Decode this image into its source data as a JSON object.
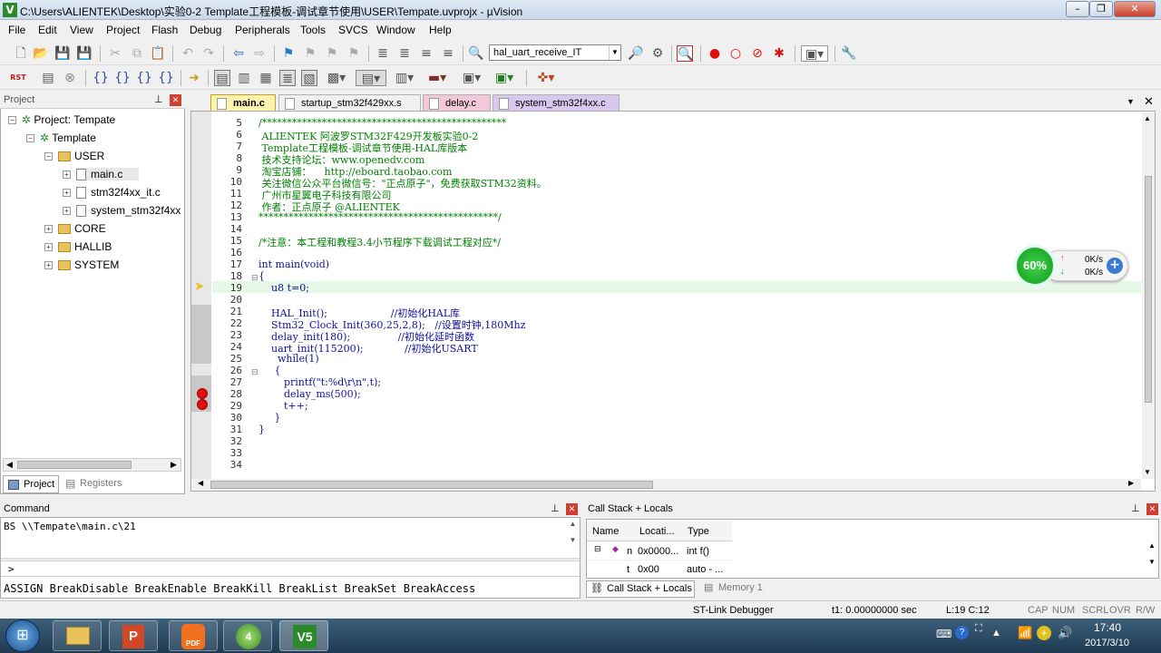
{
  "window": {
    "title": "C:\\Users\\ALIENTEK\\Desktop\\实验0-2 Template工程模板-调试章节使用\\USER\\Tempate.uvprojx - µVision"
  },
  "menu": [
    "File",
    "Edit",
    "View",
    "Project",
    "Flash",
    "Debug",
    "Peripherals",
    "Tools",
    "SVCS",
    "Window",
    "Help"
  ],
  "toolbar": {
    "target_value": "hal_uart_receive_IT"
  },
  "project_panel": {
    "title": "Project",
    "root": "Project: Tempate",
    "target": "Template",
    "groups": [
      "USER",
      "CORE",
      "HALLIB",
      "SYSTEM"
    ],
    "user_files": [
      "main.c",
      "stm32f4xx_it.c",
      "system_stm32f4xx"
    ],
    "tab_project": "Project",
    "tab_registers": "Registers"
  },
  "editor": {
    "tabs": [
      "main.c",
      "startup_stm32f429xx.s",
      "delay.c",
      "system_stm32f4xx.c"
    ],
    "lines": [
      {
        "n": "5",
        "t": "/*************************************************"
      },
      {
        "n": "6",
        "t": " ALIENTEK 阿波罗STM32F429开发板实验0-2"
      },
      {
        "n": "7",
        "t": " Template工程模板-调试章节使用-HAL库版本"
      },
      {
        "n": "8",
        "t": " 技术支持论坛：www.openedv.com"
      },
      {
        "n": "9",
        "t": " 淘宝店铺：    http://eboard.taobao.com"
      },
      {
        "n": "10",
        "t": " 关注微信公众平台微信号：\"正点原子\"，免费获取STM32资料。"
      },
      {
        "n": "11",
        "t": " 广州市星翼电子科技有限公司"
      },
      {
        "n": "12",
        "t": " 作者：正点原子 @ALIENTEK"
      },
      {
        "n": "13",
        "t": "************************************************/"
      },
      {
        "n": "14",
        "t": ""
      },
      {
        "n": "15",
        "t": "/*注意：本工程和教程3.4小节程序下载调试工程对应*/"
      },
      {
        "n": "16",
        "t": ""
      },
      {
        "n": "17",
        "t": "int main(void)"
      },
      {
        "n": "18",
        "t": "{"
      },
      {
        "n": "19",
        "t": "    u8 t=0;"
      },
      {
        "n": "20",
        "t": ""
      },
      {
        "n": "21",
        "t": "    HAL_Init();                    //初始化HAL库"
      },
      {
        "n": "22",
        "t": "    Stm32_Clock_Init(360,25,2,8);   //设置时钟,180Mhz"
      },
      {
        "n": "23",
        "t": "    delay_init(180);               //初始化延时函数"
      },
      {
        "n": "24",
        "t": "    uart_init(115200);             //初始化USART"
      },
      {
        "n": "25",
        "t": "      while(1)"
      },
      {
        "n": "26",
        "t": "     {"
      },
      {
        "n": "27",
        "t": "        printf(\"t:%d\\r\\n\",t);"
      },
      {
        "n": "28",
        "t": "        delay_ms(500);"
      },
      {
        "n": "29",
        "t": "        t++;"
      },
      {
        "n": "30",
        "t": "     }"
      },
      {
        "n": "31",
        "t": "}"
      },
      {
        "n": "32",
        "t": ""
      },
      {
        "n": "33",
        "t": ""
      },
      {
        "n": "34",
        "t": ""
      }
    ]
  },
  "net_widget": {
    "percent": "60%",
    "up": "0K/s",
    "down": "0K/s"
  },
  "command": {
    "title": "Command",
    "output": "BS \\\\Tempate\\main.c\\21",
    "prompt": ">",
    "hint": "ASSIGN BreakDisable BreakEnable BreakKill BreakList BreakSet BreakAccess"
  },
  "callstack": {
    "title": "Call Stack + Locals",
    "columns": [
      "Name",
      "Locati...",
      "Type"
    ],
    "rows": [
      {
        "name": "n",
        "loc": "0x0000...",
        "type": "int f()"
      },
      {
        "name": "t",
        "loc": "0x00",
        "type": "auto - ..."
      }
    ],
    "tab_callstack": "Call Stack + Locals",
    "tab_memory": "Memory 1"
  },
  "status": {
    "debugger": "ST-Link Debugger",
    "time": "t1: 0.00000000 sec",
    "position": "L:19 C:12",
    "cap": "CAP",
    "num": "NUM",
    "scrl": "SCRL",
    "ovr": "OVR",
    "rw": "R/W"
  },
  "clock": {
    "time": "17:40",
    "date": "2017/3/10"
  }
}
